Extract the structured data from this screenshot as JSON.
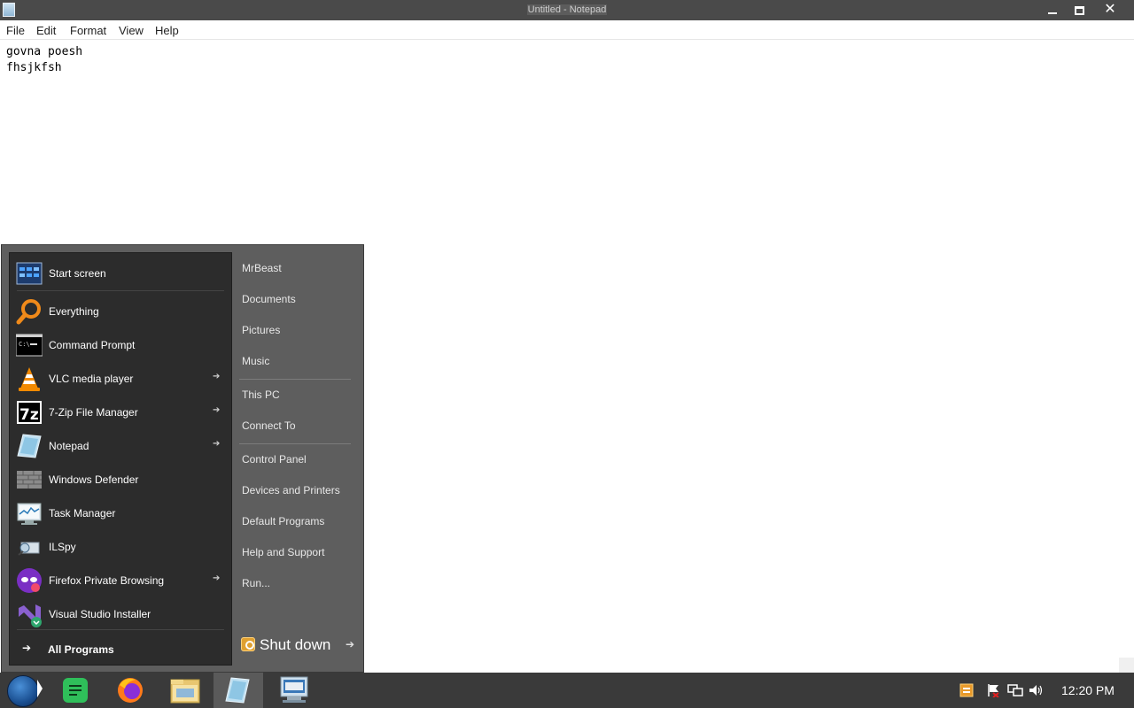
{
  "window": {
    "title": "Untitled - Notepad"
  },
  "menubar": [
    "File",
    "Edit",
    "Format",
    "View",
    "Help"
  ],
  "editor": {
    "lines": [
      "govna poesh",
      "fhsjkfsh"
    ]
  },
  "start_menu": {
    "programs": [
      {
        "label": "Start screen",
        "icon": "start-screen-icon",
        "arrow": false
      },
      {
        "label": "Everything",
        "icon": "magnifier-icon",
        "arrow": false
      },
      {
        "label": "Command Prompt",
        "icon": "cmd-icon",
        "arrow": false
      },
      {
        "label": "VLC media player",
        "icon": "vlc-cone-icon",
        "arrow": true
      },
      {
        "label": "7-Zip File Manager",
        "icon": "7zip-icon",
        "arrow": true
      },
      {
        "label": "Notepad",
        "icon": "notepad-icon",
        "arrow": true
      },
      {
        "label": "Windows Defender",
        "icon": "defender-wall-icon",
        "arrow": false
      },
      {
        "label": "Task Manager",
        "icon": "task-manager-icon",
        "arrow": false
      },
      {
        "label": "ILSpy",
        "icon": "ilspy-icon",
        "arrow": false
      },
      {
        "label": "Firefox Private Browsing",
        "icon": "firefox-private-icon",
        "arrow": true
      },
      {
        "label": "Visual Studio Installer",
        "icon": "vs-installer-icon",
        "arrow": false
      }
    ],
    "all_programs": "All Programs",
    "right_items": [
      "MrBeast",
      "Documents",
      "Pictures",
      "Music",
      "This PC",
      "Connect To",
      "Control Panel",
      "Devices and Printers",
      "Default Programs",
      "Help and Support",
      "Run..."
    ],
    "shutdown": "Shut down"
  },
  "taskbar": {
    "apps": [
      "start-orb",
      "sticky-notes-icon",
      "firefox-icon",
      "file-explorer-icon",
      "notepad-icon",
      "on-screen-keyboard-icon"
    ],
    "clock": "12:20 PM"
  }
}
